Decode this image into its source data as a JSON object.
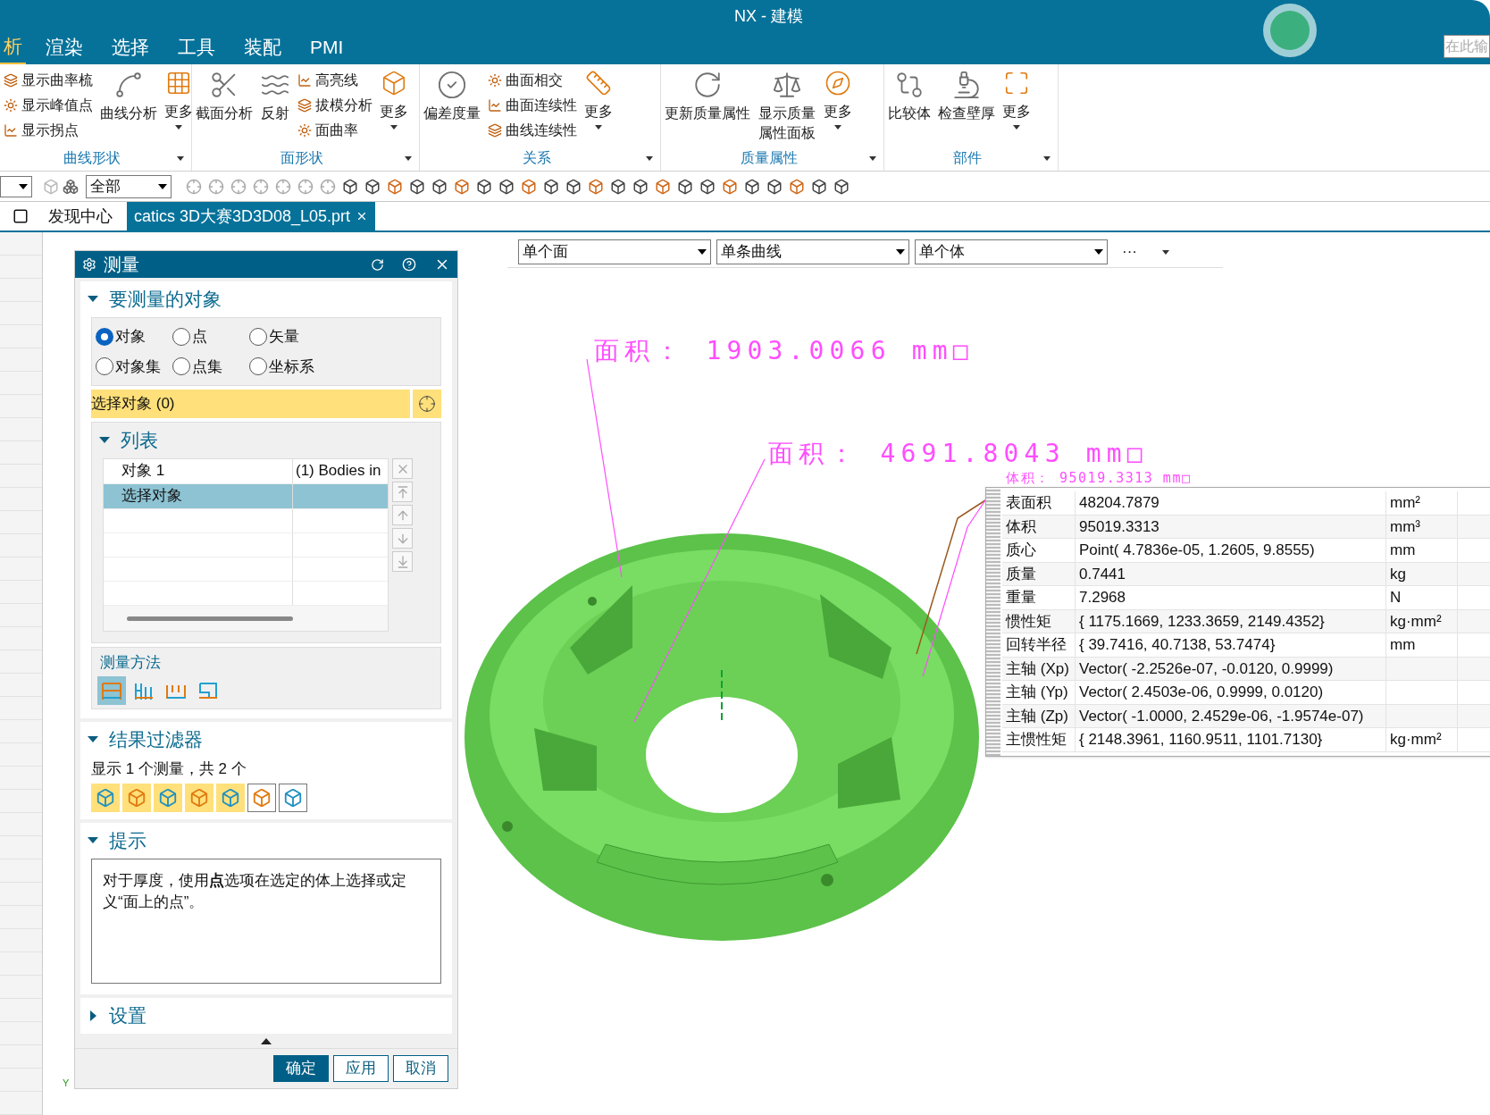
{
  "window": {
    "title": "NX - 建模",
    "search": {
      "placeholder": "在此输"
    }
  },
  "menu_tabs": [
    {
      "label": "析",
      "selected": true
    },
    {
      "label": "渲染",
      "selected": false
    },
    {
      "label": "选择",
      "selected": false
    },
    {
      "label": "工具",
      "selected": false
    },
    {
      "label": "装配",
      "selected": false
    },
    {
      "label": "PMI",
      "selected": false
    }
  ],
  "ribbon": {
    "groups": [
      {
        "title": "曲线形状",
        "items": [
          {
            "label": "显示曲率梳",
            "kind": "small"
          },
          {
            "label": "显示峰值点",
            "kind": "small"
          },
          {
            "label": "显示拐点",
            "kind": "small"
          },
          {
            "label": "曲线分析",
            "kind": "large"
          },
          {
            "label": "更多",
            "kind": "more"
          }
        ]
      },
      {
        "title": "面形状",
        "items": [
          {
            "label": "截面分析",
            "kind": "large"
          },
          {
            "label": "反射",
            "kind": "large"
          },
          {
            "label": "高亮线",
            "kind": "small"
          },
          {
            "label": "拔模分析",
            "kind": "small"
          },
          {
            "label": "面曲率",
            "kind": "small"
          },
          {
            "label": "更多",
            "kind": "more"
          }
        ]
      },
      {
        "title": "关系",
        "items": [
          {
            "label": "偏差度量",
            "kind": "large"
          },
          {
            "label": "曲面相交",
            "kind": "small"
          },
          {
            "label": "曲面连续性",
            "kind": "small"
          },
          {
            "label": "曲线连续性",
            "kind": "small"
          },
          {
            "label": "更多",
            "kind": "more"
          }
        ]
      },
      {
        "title": "质量属性",
        "items": [
          {
            "label": "更新质量属性",
            "kind": "large"
          },
          {
            "label": "显示质量属性面板",
            "kind": "large"
          },
          {
            "label": "更多",
            "kind": "more"
          }
        ]
      },
      {
        "title": "部件",
        "items": [
          {
            "label": "比较体",
            "kind": "large"
          },
          {
            "label": "检查壁厚",
            "kind": "large"
          },
          {
            "label": "更多",
            "kind": "more"
          }
        ]
      }
    ]
  },
  "toolbar": {
    "filter": "全部"
  },
  "doc_tabs": [
    {
      "label": "发现中心",
      "selected": false
    },
    {
      "label": "catics 3D大赛3D3D08_L05.prt",
      "selected": true
    }
  ],
  "selection_bar": {
    "filters": [
      "单个面",
      "单条曲线",
      "单个体"
    ],
    "more": "···"
  },
  "dialog": {
    "title": "测量",
    "objects_section": {
      "title": "要测量的对象",
      "expanded": true,
      "types": [
        {
          "label": "对象",
          "selected": true
        },
        {
          "label": "点",
          "selected": false
        },
        {
          "label": "矢量",
          "selected": false
        },
        {
          "label": "对象集",
          "selected": false
        },
        {
          "label": "点集",
          "selected": false
        },
        {
          "label": "坐标系",
          "selected": false
        }
      ],
      "select_label": "选择对象 (0)",
      "list": {
        "title": "列表",
        "expanded": true,
        "rows": [
          {
            "name": "对象 1",
            "value": "(1) Bodies in",
            "selected": false
          },
          {
            "name": "选择对象",
            "selected": true
          }
        ]
      },
      "method": {
        "title": "测量方法",
        "options": [
          {
            "selected": true
          },
          {
            "selected": false
          },
          {
            "selected": false
          },
          {
            "selected": false
          }
        ]
      }
    },
    "filter_section": {
      "title": "结果过滤器",
      "expanded": true,
      "summary": "显示 1 个测量，共 2 个",
      "filters": [
        {
          "on": true
        },
        {
          "on": true
        },
        {
          "on": true
        },
        {
          "on": true
        },
        {
          "on": true
        },
        {
          "on": false
        },
        {
          "on": false
        }
      ]
    },
    "hint_section": {
      "title": "提示",
      "expanded": true,
      "text": "对于厚度，使用**点**选项在选定的体上选择或定义“面上的点”。"
    },
    "settings_section": {
      "title": "设置",
      "expanded": false
    },
    "buttons": [
      {
        "label": "确定",
        "primary": true
      },
      {
        "label": "应用",
        "primary": false
      },
      {
        "label": "取消",
        "primary": false
      }
    ]
  },
  "annotations": [
    {
      "text": "面积： 1903.0066 mm□",
      "kind": "large"
    },
    {
      "text": "面积： 4691.8043 mm□",
      "kind": "large"
    },
    {
      "text": "体积： 95019.3313 mm□",
      "kind": "small"
    }
  ],
  "axis_label": "Y",
  "results": [
    {
      "label": "表面积",
      "value": "48204.7879",
      "unit": "mm²"
    },
    {
      "label": "体积",
      "value": "95019.3313",
      "unit": "mm³"
    },
    {
      "label": "质心",
      "value": "Point( 4.7836e-05, 1.2605, 9.8555)",
      "unit": "mm"
    },
    {
      "label": "质量",
      "value": "0.7441",
      "unit": "kg"
    },
    {
      "label": "重量",
      "value": "7.2968",
      "unit": "N"
    },
    {
      "label": "惯性矩",
      "value": "{ 1175.1669, 1233.3659, 2149.4352}",
      "unit": "kg·mm²"
    },
    {
      "label": "回转半径",
      "value": "{ 39.7416, 40.7138, 53.7474}",
      "unit": "mm"
    },
    {
      "label": "主轴 (Xp)",
      "value": "Vector( -2.2526e-07, -0.0120, 0.9999)"
    },
    {
      "label": "主轴 (Yp)",
      "value": "Vector( 2.4503e-06, 0.9999, 0.0120)"
    },
    {
      "label": "主轴 (Zp)",
      "value": "Vector( -1.0000, 2.4529e-06, -1.9574e-07)"
    },
    {
      "label": "主惯性矩",
      "value": "{ 2148.3961, 1160.9511, 1101.7130}",
      "unit": "kg·mm²"
    }
  ]
}
